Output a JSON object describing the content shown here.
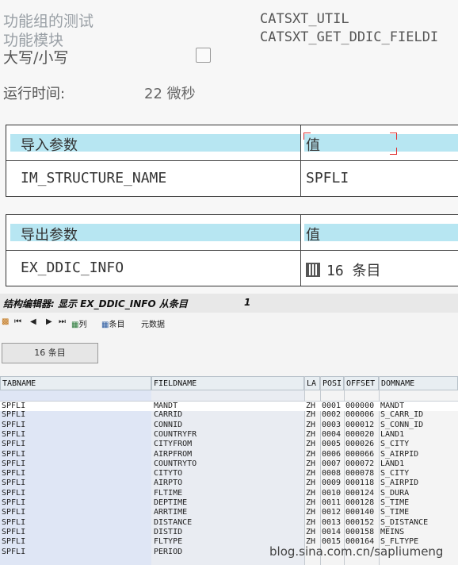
{
  "header": {
    "func_group_label": "功能组的测试",
    "func_module_label": "功能模块",
    "case_label": "大写/小写",
    "func_group_value": "CATSXT_UTIL",
    "func_module_value": "CATSXT_GET_DDIC_FIELDI",
    "runtime_label": "运行时间:",
    "runtime_value": "22 微秒"
  },
  "import_params": {
    "col_param": "导入参数",
    "col_value": "值",
    "rows": [
      {
        "name": "IM_STRUCTURE_NAME",
        "value": "SPFLI"
      }
    ]
  },
  "export_params": {
    "col_param": "导出参数",
    "col_value": "值",
    "rows": [
      {
        "name": "EX_DDIC_INFO",
        "value": "16 条目"
      }
    ]
  },
  "structure_editor": {
    "title": "结构编辑器: 显示 EX_DDIC_INFO 从条目",
    "number": "1",
    "toolbar": {
      "first": "⏮",
      "prev": "◀",
      "next": "▶",
      "last": "⏭",
      "columns_label": "列",
      "entries_label": "条目",
      "metadata_label": "元数据"
    },
    "count_button": "16 条目",
    "columns": [
      "TABNAME",
      "FIELDNAME",
      "LA",
      "POSI",
      "OFFSET",
      "DOMNAME"
    ],
    "rows": [
      [
        "SPFLI",
        "MANDT",
        "ZH",
        "0001",
        "000000",
        "MANDT"
      ],
      [
        "SPFLI",
        "CARRID",
        "ZH",
        "0002",
        "000006",
        "S_CARR_ID"
      ],
      [
        "SPFLI",
        "CONNID",
        "ZH",
        "0003",
        "000012",
        "S_CONN_ID"
      ],
      [
        "SPFLI",
        "COUNTRYFR",
        "ZH",
        "0004",
        "000020",
        "LAND1"
      ],
      [
        "SPFLI",
        "CITYFROM",
        "ZH",
        "0005",
        "000026",
        "S_CITY"
      ],
      [
        "SPFLI",
        "AIRPFROM",
        "ZH",
        "0006",
        "000066",
        "S_AIRPID"
      ],
      [
        "SPFLI",
        "COUNTRYTO",
        "ZH",
        "0007",
        "000072",
        "LAND1"
      ],
      [
        "SPFLI",
        "CITYTO",
        "ZH",
        "0008",
        "000078",
        "S_CITY"
      ],
      [
        "SPFLI",
        "AIRPTO",
        "ZH",
        "0009",
        "000118",
        "S_AIRPID"
      ],
      [
        "SPFLI",
        "FLTIME",
        "ZH",
        "0010",
        "000124",
        "S_DURA"
      ],
      [
        "SPFLI",
        "DEPTIME",
        "ZH",
        "0011",
        "000128",
        "S_TIME"
      ],
      [
        "SPFLI",
        "ARRTIME",
        "ZH",
        "0012",
        "000140",
        "S_TIME"
      ],
      [
        "SPFLI",
        "DISTANCE",
        "ZH",
        "0013",
        "000152",
        "S_DISTANCE"
      ],
      [
        "SPFLI",
        "DISTID",
        "ZH",
        "0014",
        "000158",
        "MEINS"
      ],
      [
        "SPFLI",
        "FLTYPE",
        "ZH",
        "0015",
        "000164",
        "S_FLTYPE"
      ],
      [
        "SPFLI",
        "PERIOD",
        "",
        "",
        "",
        ""
      ]
    ]
  },
  "watermark": "blog.sina.com.cn/sapliumeng"
}
